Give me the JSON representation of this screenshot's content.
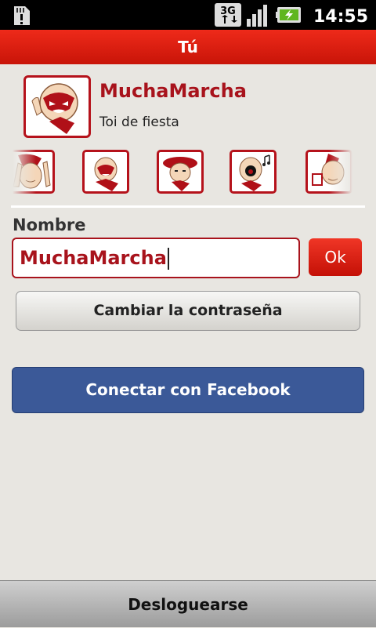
{
  "status_bar": {
    "time": "14:55",
    "network": "3G",
    "icons": [
      "sd-card-alert-icon",
      "3g-data-icon",
      "signal-bars-icon",
      "battery-charging-icon"
    ]
  },
  "header": {
    "title": "Tú"
  },
  "profile": {
    "name": "MuchaMarcha",
    "status": "Toi de fiesta"
  },
  "avatars": [
    "avatar-arms-up-icon",
    "avatar-angry-bandana-icon",
    "avatar-beret-icon",
    "avatar-singing-icon",
    "avatar-drinking-icon"
  ],
  "form": {
    "label": "Nombre",
    "value": "MuchaMarcha",
    "ok_label": "Ok",
    "change_password_label": "Cambiar la contraseña",
    "facebook_label": "Conectar con Facebook"
  },
  "footer": {
    "logout_label": "Desloguearse"
  },
  "colors": {
    "brand_red": "#c81408",
    "facebook_blue": "#3b5998",
    "background": "#e8e6e1"
  }
}
